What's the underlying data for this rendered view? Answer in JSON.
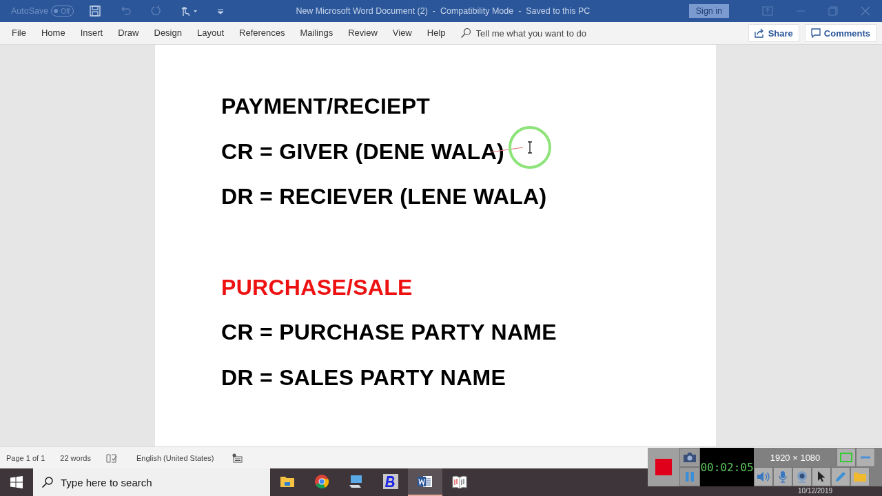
{
  "title_bar": {
    "autosave_label": "AutoSave",
    "autosave_state": "Off",
    "autosave_on": false,
    "title": "New Microsoft Word Document (2)  -  Compatibility Mode  -  Saved to this PC",
    "sign_in": "Sign in"
  },
  "ribbon": {
    "tabs": [
      {
        "label": "File",
        "selected": false
      },
      {
        "label": "Home",
        "selected": false
      },
      {
        "label": "Insert",
        "selected": false
      },
      {
        "label": "Draw",
        "selected": false
      },
      {
        "label": "Design",
        "selected": false
      },
      {
        "label": "Layout",
        "selected": false
      },
      {
        "label": "References",
        "selected": false
      },
      {
        "label": "Mailings",
        "selected": false
      },
      {
        "label": "Review",
        "selected": false
      },
      {
        "label": "View",
        "selected": false
      },
      {
        "label": "Help",
        "selected": false
      }
    ],
    "tell_me": {
      "placeholder": "Tell me what you want to do"
    },
    "share": "Share",
    "comments": "Comments"
  },
  "document": {
    "sections": [
      {
        "paragraphs": [
          {
            "text": "PAYMENT/RECIEPT",
            "color": "#000000"
          },
          {
            "text": "CR = GIVER (DENE WALA)",
            "color": "#000000"
          },
          {
            "text": "DR = RECIEVER (LENE WALA)",
            "color": "#000000"
          }
        ]
      },
      {
        "paragraphs": [
          {
            "text": "PURCHASE/SALE",
            "color": "#ee1111"
          },
          {
            "text": "CR = PURCHASE PARTY NAME",
            "color": "#000000"
          },
          {
            "text": "DR = SALES PARTY NAME",
            "color": "#000000"
          }
        ]
      }
    ]
  },
  "status_bar": {
    "page": "Page 1 of 1",
    "words": "22 words",
    "language": "English (United States)"
  },
  "taskbar": {
    "search": {
      "placeholder": "Type here to search"
    },
    "apps": [
      {
        "kind": "folder",
        "selected": false
      },
      {
        "kind": "chrome",
        "selected": false
      },
      {
        "kind": "computer",
        "selected": false
      },
      {
        "kind": "bold-b",
        "selected": false
      },
      {
        "kind": "word",
        "selected": true
      },
      {
        "kind": "book",
        "selected": false
      }
    ],
    "date": "10/12/2019"
  },
  "recorder": {
    "timer": "00:02:05",
    "resolution": "1920 × 1080"
  }
}
